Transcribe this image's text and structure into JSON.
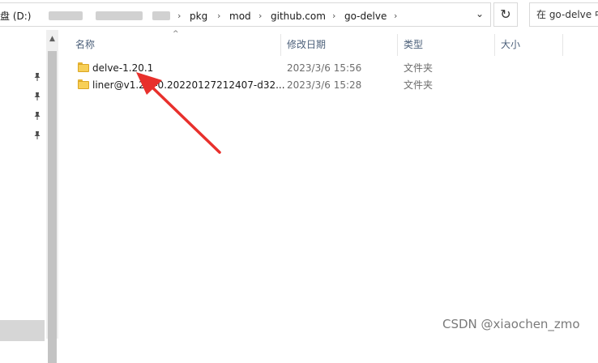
{
  "address_bar": {
    "drive_label": "盘 (D:)",
    "crumbs": [
      "pkg",
      "mod",
      "github.com",
      "go-delve"
    ],
    "dropdown_glyph": "⌄",
    "refresh_glyph": "↻",
    "search_placeholder": "在 go-delve 中"
  },
  "columns": {
    "name": "名称",
    "modified": "修改日期",
    "type": "类型",
    "size": "大小"
  },
  "files": [
    {
      "name": "delve-1.20.1",
      "modified": "2023/3/6 15:56",
      "type": "文件夹",
      "size": ""
    },
    {
      "name": "liner@v1.2.2-0.20220127212407-d32...",
      "modified": "2023/3/6 15:28",
      "type": "文件夹",
      "size": ""
    }
  ],
  "nav": {
    "pin_glyph": "📌"
  },
  "icons": {
    "folder": "folder-icon",
    "pin": "pin-icon",
    "refresh": "refresh-icon",
    "sort": "sort-up-icon"
  },
  "annotation": {
    "arrow_color": "#e8302c"
  },
  "watermark": "CSDN @xiaochen_zmo"
}
